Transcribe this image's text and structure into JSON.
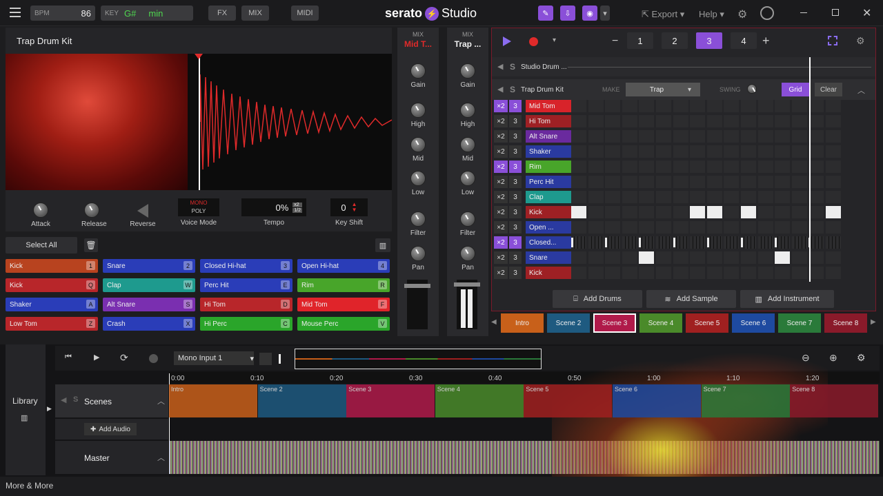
{
  "topbar": {
    "bpm_label": "BPM",
    "bpm": "86",
    "key_label": "KEY",
    "key": "G#",
    "mode": "min",
    "fx": "FX",
    "mix": "MIX",
    "midi": "MIDI",
    "brand": "serato",
    "brand2": "Studio",
    "export": "Export",
    "help": "Help"
  },
  "sample": {
    "title": "Trap Drum Kit",
    "attack": "Attack",
    "release": "Release",
    "reverse": "Reverse",
    "voice_top": "MONO",
    "voice_bottom": "POLY",
    "voice_label": "Voice Mode",
    "tempo_val": "0%",
    "tempo_x2": "x2",
    "tempo_half": "1/2",
    "tempo_label": "Tempo",
    "keyshift_val": "0",
    "keyshift_label": "Key Shift",
    "select_all": "Select All"
  },
  "pads": [
    {
      "name": "Kick",
      "key": "1",
      "color": "#b8431f"
    },
    {
      "name": "Snare",
      "key": "2",
      "color": "#2a3db8"
    },
    {
      "name": "Closed Hi-hat",
      "key": "3",
      "color": "#2a3db8"
    },
    {
      "name": "Open Hi-hat",
      "key": "4",
      "color": "#2a3db8"
    },
    {
      "name": "Kick",
      "key": "Q",
      "color": "#b8262a"
    },
    {
      "name": "Clap",
      "key": "W",
      "color": "#1e9a8e"
    },
    {
      "name": "Perc Hit",
      "key": "E",
      "color": "#2a3db8"
    },
    {
      "name": "Rim",
      "key": "R",
      "color": "#48a52a"
    },
    {
      "name": "Shaker",
      "key": "A",
      "color": "#2a3db8"
    },
    {
      "name": "Alt Snare",
      "key": "S",
      "color": "#7a2fb0"
    },
    {
      "name": "Hi Tom",
      "key": "D",
      "color": "#b8262a"
    },
    {
      "name": "Mid Tom",
      "key": "F",
      "color": "#e0242a"
    },
    {
      "name": "Low Tom",
      "key": "Z",
      "color": "#b8262a"
    },
    {
      "name": "Crash",
      "key": "X",
      "color": "#2a3db8"
    },
    {
      "name": "Hi Perc",
      "key": "C",
      "color": "#2aa52a"
    },
    {
      "name": "Mouse Perc",
      "key": "V",
      "color": "#2aa52a"
    }
  ],
  "mixer": [
    {
      "mix": "MIX",
      "name": "Mid T...",
      "gain": "Gain",
      "high": "High",
      "mid": "Mid",
      "low": "Low",
      "filter": "Filter",
      "pan": "Pan"
    },
    {
      "mix": "MIX",
      "name": "Trap ...",
      "gain": "Gain",
      "high": "High",
      "mid": "Mid",
      "low": "Low",
      "filter": "Filter",
      "pan": "Pan"
    }
  ],
  "seq": {
    "patterns": [
      "1",
      "2",
      "3",
      "4"
    ],
    "studio_drum": "Studio Drum ...",
    "kit": "Trap Drum Kit",
    "make": "MAKE",
    "make_val": "Trap",
    "swing": "SWING",
    "grid": "Grid",
    "clear": "Clear",
    "rows": [
      {
        "x2": "×2",
        "n": "3",
        "name": "Mid Tom",
        "color": "#d8232a",
        "act": true,
        "steps": []
      },
      {
        "x2": "×2",
        "n": "3",
        "name": "Hi Tom",
        "color": "#9e2024",
        "act": false,
        "steps": []
      },
      {
        "x2": "×2",
        "n": "3",
        "name": "Alt Snare",
        "color": "#6a2a9e",
        "act": false,
        "steps": []
      },
      {
        "x2": "×2",
        "n": "3",
        "name": "Shaker",
        "color": "#2a3aa0",
        "act": false,
        "steps": []
      },
      {
        "x2": "×2",
        "n": "3",
        "name": "Rim",
        "color": "#48a52a",
        "act": true,
        "steps": []
      },
      {
        "x2": "×2",
        "n": "3",
        "name": "Perc Hit",
        "color": "#2a3aa0",
        "act": false,
        "steps": []
      },
      {
        "x2": "×2",
        "n": "3",
        "name": "Clap",
        "color": "#1e9a8e",
        "act": false,
        "steps": []
      },
      {
        "x2": "×2",
        "n": "3",
        "name": "Kick",
        "color": "#9e2024",
        "act": false,
        "steps": [
          0,
          7,
          8,
          10,
          15
        ]
      },
      {
        "x2": "×2",
        "n": "3",
        "name": "Open ...",
        "color": "#2a3aa0",
        "act": false,
        "steps": []
      },
      {
        "x2": "×2",
        "n": "3",
        "name": "Closed...",
        "color": "#2a3aa0",
        "act": true,
        "steps": []
      },
      {
        "x2": "×2",
        "n": "3",
        "name": "Snare",
        "color": "#2a3aa0",
        "act": false,
        "steps": [
          4,
          12
        ]
      },
      {
        "x2": "×2",
        "n": "3",
        "name": "Kick",
        "color": "#9e2024",
        "act": false,
        "steps": []
      }
    ],
    "add_drums": "Add Drums",
    "add_sample": "Add Sample",
    "add_instrument": "Add Instrument"
  },
  "scenes": [
    {
      "name": "Intro",
      "color": "#c8601a"
    },
    {
      "name": "Scene 2",
      "color": "#1e5a80"
    },
    {
      "name": "Scene 3",
      "color": "#b01a4a",
      "active": true
    },
    {
      "name": "Scene 4",
      "color": "#4a8a2a"
    },
    {
      "name": "Scene 5",
      "color": "#a02020"
    },
    {
      "name": "Scene 6",
      "color": "#1e4aa0"
    },
    {
      "name": "Scene 7",
      "color": "#2a7a3a"
    },
    {
      "name": "Scene 8",
      "color": "#8a1a2a"
    }
  ],
  "arrange": {
    "input": "Mono Input 1",
    "library": "Library",
    "scenes": "Scenes",
    "add_audio": "Add Audio",
    "master": "Master",
    "ticks": [
      "0:00",
      "0:10",
      "0:20",
      "0:30",
      "0:40",
      "0:50",
      "1:00",
      "1:10",
      "1:20"
    ]
  },
  "footer": "More & More"
}
